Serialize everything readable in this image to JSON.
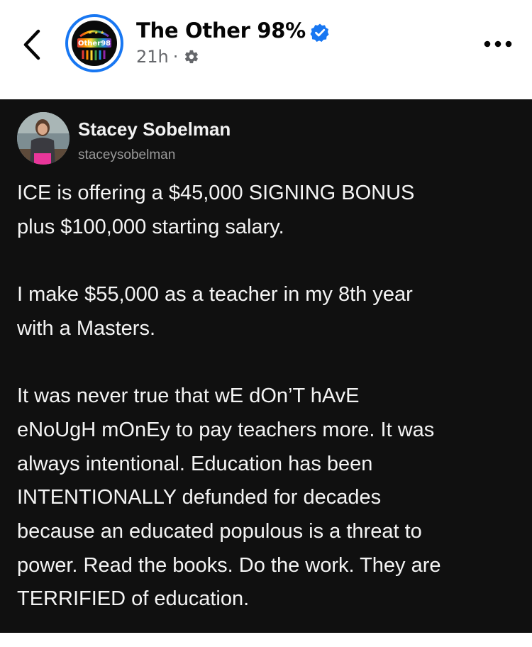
{
  "header": {
    "page_name": "The Other 98%",
    "time_ago": "21h",
    "separator": "·",
    "logo_text": "Other98",
    "icons": {
      "back": "chevron-left-icon",
      "verified": "verified-badge-icon",
      "audience": "gear-icon",
      "more": "more-horizontal-icon"
    },
    "colors": {
      "verified": "#1877f2",
      "meta": "#65676b"
    }
  },
  "post": {
    "author_name": "Stacey Sobelman",
    "author_handle": "staceysobelman",
    "paragraphs": [
      {
        "lines": [
          "ICE is offering a $45,000 SIGNING BONUS",
          "plus $100,000 starting salary."
        ]
      },
      {
        "lines": [
          "I make $55,000 as a teacher in my 8th year",
          "with a Masters."
        ]
      },
      {
        "lines": [
          "It was never true that wE dOn’T hAvE",
          "eNoUgH mOnEy to pay teachers more. It was",
          "always intentional. Education has been",
          "INTENTIONALLY defunded for decades",
          "because an educated populous is a threat to",
          "power. Read the books. Do the work. They are",
          "TERRIFIED of education."
        ]
      }
    ],
    "colors": {
      "background": "#101010",
      "text": "#f4f4f4",
      "handle": "#9a9a9a"
    }
  }
}
